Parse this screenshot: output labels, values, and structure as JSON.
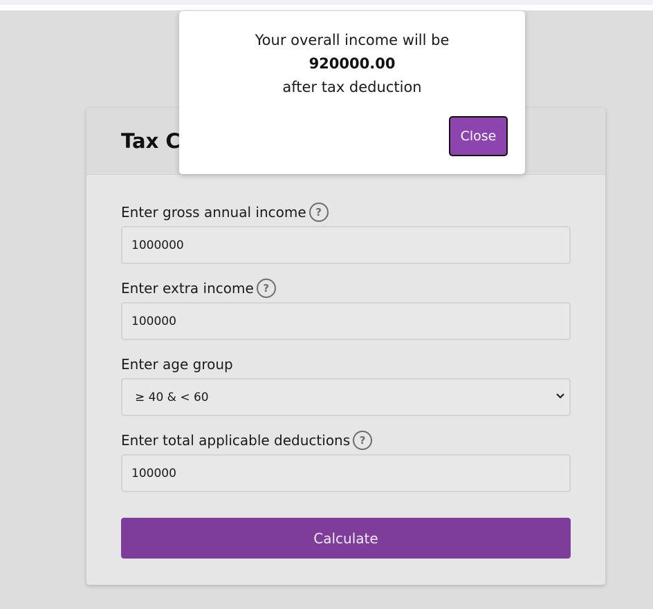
{
  "card": {
    "title": "Tax Calculator",
    "gross_income": {
      "label": "Enter gross annual income",
      "value": "1000000"
    },
    "extra_income": {
      "label": "Enter extra income",
      "value": "100000"
    },
    "age_group": {
      "label": "Enter age group",
      "value": "≥ 40 & < 60"
    },
    "deductions": {
      "label": "Enter total applicable deductions",
      "value": "100000"
    },
    "calculate_label": "Calculate",
    "help_glyph": "?"
  },
  "modal": {
    "line1": "Your overall income will be",
    "amount": "920000.00",
    "line3": "after tax deduction",
    "close_label": "Close"
  },
  "colors": {
    "accent": "#7e3d9a",
    "close_button": "#8e44ad"
  }
}
